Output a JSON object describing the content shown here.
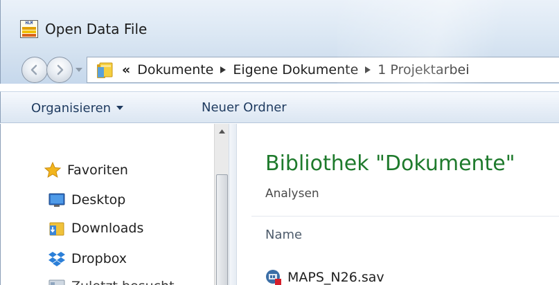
{
  "window": {
    "title": "Open Data File",
    "app_icon_text": "HLM"
  },
  "icons": {
    "back": "back-arrow-icon",
    "forward": "forward-arrow-icon",
    "history": "chevron-down-icon",
    "folder": "library-folder-icon",
    "crumb_separator": "chevron-right-icon",
    "favorites": "star-icon",
    "desktop": "desktop-icon",
    "downloads": "downloads-folder-icon",
    "dropbox": "dropbox-icon",
    "recent": "recent-places-icon",
    "file": "sav-data-file-icon"
  },
  "address_bar": {
    "overflow": "«",
    "crumbs": [
      "Dokumente",
      "Eigene Dokumente",
      "1 Projektarbei"
    ]
  },
  "command_bar": {
    "organize_label": "Organisieren",
    "new_folder_label": "Neuer Ordner"
  },
  "nav_pane": {
    "items": [
      {
        "label": "Favoriten"
      },
      {
        "label": "Desktop"
      },
      {
        "label": "Downloads"
      },
      {
        "label": "Dropbox"
      },
      {
        "label": "Zuletzt besucht"
      }
    ]
  },
  "content": {
    "library_title": "Bibliothek \"Dokumente\"",
    "library_subtitle": "Analysen",
    "column_name": "Name",
    "files": [
      {
        "name": "MAPS_N26.sav"
      }
    ]
  },
  "colors": {
    "library_title": "#1e7a2c",
    "command_text": "#1e3a5f",
    "favorites_star": "#f2b51d"
  }
}
